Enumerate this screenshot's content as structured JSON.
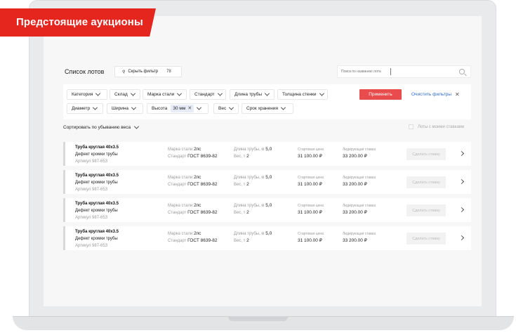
{
  "banner": {
    "title": "Предстоящие аукционы"
  },
  "header": {
    "list_title": "Список лотов",
    "hide_filter_label": "Скрыть фильтр",
    "hide_filter_count": "78",
    "search_placeholder": "Поиск по названию лота"
  },
  "filters": {
    "row1": [
      "Категория",
      "Склад",
      "Марка стали",
      "Стандарт",
      "Длина трубы",
      "Толщина стенки"
    ],
    "row2": {
      "diameter": "Диаметр",
      "width": "Ширина",
      "height": "Высота",
      "height_tag": "30 мм",
      "weight": "Вес",
      "storage": "Срок хранения"
    },
    "apply_label": "Применить",
    "clear_label": "Очистить фильтры"
  },
  "sort": {
    "label": "Сортировать по убыванию веса",
    "my_bids_label": "Лоты с моими ставками"
  },
  "lots": [
    {
      "name": "Труба круглая 40х3.5",
      "defect": "Дефект кромки трубы",
      "article": "Артикул 987-653",
      "steel_label": "Марка стали",
      "steel_value": "2пс",
      "standard_label": "Стандарт",
      "standard_value": "ГОСТ 8639-82",
      "length_label": "Длина трубы, м",
      "length_value": "5,0",
      "weight_label": "Вес, т",
      "weight_value": "2",
      "start_price_label": "Стартовая цена",
      "start_price": "31 100.00 ₽",
      "leading_bid_label": "Лидирующая ставка",
      "leading_bid": "33 200.00 ₽",
      "bid_button": "Сделать ставку"
    },
    {
      "name": "Труба круглая 40х3.5",
      "defect": "Дефект кромки трубы",
      "article": "Артикул 987-653",
      "steel_label": "Марка стали",
      "steel_value": "2пс",
      "standard_label": "Стандарт",
      "standard_value": "ГОСТ 8639-82",
      "length_label": "Длина трубы, м",
      "length_value": "5,0",
      "weight_label": "Вес, т",
      "weight_value": "2",
      "start_price_label": "Стартовая цена",
      "start_price": "31 100.00 ₽",
      "leading_bid_label": "Лидирующая ставка",
      "leading_bid": "33 200.00 ₽",
      "bid_button": "Сделать ставку"
    },
    {
      "name": "Труба круглая 40х3.5",
      "defect": "Дефект кромки трубы",
      "article": "Артикул 987-653",
      "steel_label": "Марка стали",
      "steel_value": "2пс",
      "standard_label": "Стандарт",
      "standard_value": "ГОСТ 8639-82",
      "length_label": "Длина трубы, м",
      "length_value": "5,0",
      "weight_label": "Вес, т",
      "weight_value": "2",
      "start_price_label": "Стартовая цена",
      "start_price": "31 100.00 ₽",
      "leading_bid_label": "Лидирующая ставка",
      "leading_bid": "33 200.00 ₽",
      "bid_button": "Сделать ставку"
    },
    {
      "name": "Труба круглая 40х3.5",
      "defect": "Дефект кромки трубы",
      "article": "Артикул 987-653",
      "steel_label": "Марка стали",
      "steel_value": "2пс",
      "standard_label": "Стандарт",
      "standard_value": "ГОСТ 8639-82",
      "length_label": "Длина трубы, м",
      "length_value": "5,0",
      "weight_label": "Вес, т",
      "weight_value": "2",
      "start_price_label": "Стартовая цена",
      "start_price": "31 100.00 ₽",
      "leading_bid_label": "Лидирующая ставка",
      "leading_bid": "33 200.00 ₽",
      "bid_button": "Сделать ставку"
    }
  ],
  "colors": {
    "accent_red": "#e4261f",
    "apply_red": "#e84c4c",
    "link_blue": "#2f6bd0"
  }
}
